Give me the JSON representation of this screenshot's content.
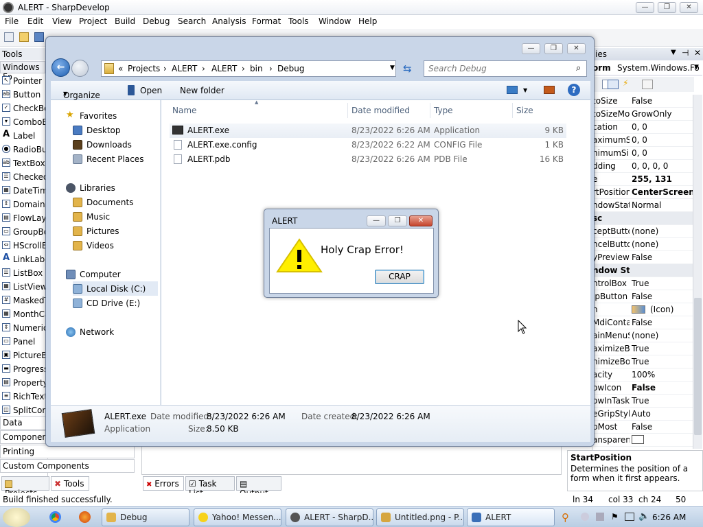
{
  "ide": {
    "title": "ALERT - SharpDevelop",
    "menu": [
      "File",
      "Edit",
      "View",
      "Project",
      "Build",
      "Debug",
      "Search",
      "Analysis",
      "Format",
      "Tools",
      "Window",
      "Help"
    ],
    "tools_header": "Tools",
    "tools_category": "Windows Fo",
    "tools": [
      "Pointer",
      "Button",
      "CheckBo",
      "ComboBo",
      "Label",
      "RadioBut",
      "TextBox",
      "Checked",
      "DateTim",
      "DomainU",
      "FlowLayo",
      "GroupBo",
      "HScrollB",
      "LinkLabe",
      "ListBox",
      "ListView",
      "MaskedT",
      "MonthCa",
      "Numeric",
      "Panel",
      "PictureBo",
      "Progress",
      "Property",
      "RichText",
      "SplitCont"
    ],
    "categories": [
      "Data",
      "Component",
      "Printing",
      "Custom Components"
    ],
    "left_tabs": [
      "Projects",
      "Tools"
    ],
    "bottom_tabs": [
      "Errors",
      "Task List",
      "Output"
    ],
    "status": {
      "message": "Build finished successfully.",
      "line": "ln 34",
      "col": "col 33",
      "ch": "ch 24",
      "num": "50"
    }
  },
  "properties": {
    "header": "ies",
    "object": "orm",
    "object_type": "System.Windows.Fo",
    "rows": [
      {
        "k": "toSize",
        "v": "False"
      },
      {
        "k": "toSizeMo",
        "v": "GrowOnly"
      },
      {
        "k": "cation",
        "v": "0, 0"
      },
      {
        "k": "aximumSi",
        "v": "0, 0"
      },
      {
        "k": "nimumSi",
        "v": "0, 0"
      },
      {
        "k": "dding",
        "v": "0, 0, 0, 0"
      },
      {
        "k": "e",
        "v": "255, 131",
        "bold": true
      },
      {
        "k": "rtPosition",
        "v": "CenterScreen",
        "bold": true
      },
      {
        "k": "ndowStat",
        "v": "Normal"
      },
      {
        "k": "sc",
        "v": "",
        "section": true
      },
      {
        "k": "ceptButto",
        "v": "(none)"
      },
      {
        "k": "ncelButto",
        "v": "(none)"
      },
      {
        "k": "yPreview",
        "v": "False"
      },
      {
        "k": "ndow Style",
        "v": "",
        "section": true
      },
      {
        "k": "ntrolBox",
        "v": "True"
      },
      {
        "k": "lpButton",
        "v": "False"
      },
      {
        "k": "n",
        "v": "(Icon)"
      },
      {
        "k": "MdiContai",
        "v": "False"
      },
      {
        "k": "ainMenuS",
        "v": "(none)"
      },
      {
        "k": "aximizeBo",
        "v": "True"
      },
      {
        "k": "nimizeBo",
        "v": "True"
      },
      {
        "k": "acity",
        "v": "100%"
      },
      {
        "k": "owIcon",
        "v": "False",
        "bold": true
      },
      {
        "k": "owInTask",
        "v": "True"
      },
      {
        "k": "eGripStyl",
        "v": "Auto"
      },
      {
        "k": "pMost",
        "v": "False"
      },
      {
        "k": "ansparenc",
        "v": ""
      }
    ],
    "desc_title": "StartPosition",
    "desc_text": "Determines the position of a form when it first appears."
  },
  "explorer": {
    "breadcrumb": [
      "Projects",
      "ALERT",
      "ALERT",
      "bin",
      "Debug"
    ],
    "search_placeholder": "Search Debug",
    "commands": [
      "Organize",
      "Open",
      "New folder"
    ],
    "nav": {
      "favorites": "Favorites",
      "fav_items": [
        "Desktop",
        "Downloads",
        "Recent Places"
      ],
      "libraries": "Libraries",
      "lib_items": [
        "Documents",
        "Music",
        "Pictures",
        "Videos"
      ],
      "computer": "Computer",
      "comp_items": [
        "Local Disk (C:)",
        "CD Drive (E:)"
      ],
      "network": "Network"
    },
    "columns": [
      "Name",
      "Date modified",
      "Type",
      "Size"
    ],
    "files": [
      {
        "name": "ALERT.exe",
        "date": "8/23/2022 6:26 AM",
        "type": "Application",
        "size": "9 KB"
      },
      {
        "name": "ALERT.exe.config",
        "date": "8/23/2022 6:22 AM",
        "type": "CONFIG File",
        "size": "1 KB"
      },
      {
        "name": "ALERT.pdb",
        "date": "8/23/2022 6:26 AM",
        "type": "PDB File",
        "size": "16 KB"
      }
    ],
    "details": {
      "name": "ALERT.exe",
      "kind": "Application",
      "mod_label": "Date modified:",
      "mod_value": "8/23/2022 6:26 AM",
      "size_label": "Size:",
      "size_value": "8.50 KB",
      "created_label": "Date created:",
      "created_value": "8/23/2022 6:26 AM"
    }
  },
  "alert": {
    "title": "ALERT",
    "message": "Holy Crap Error!",
    "button": "CRAP"
  },
  "taskbar": {
    "items": [
      "Debug",
      "Yahoo! Messen...",
      "ALERT - SharpD...",
      "Untitled.png - P...",
      "ALERT"
    ],
    "clock": "6:26 AM"
  }
}
